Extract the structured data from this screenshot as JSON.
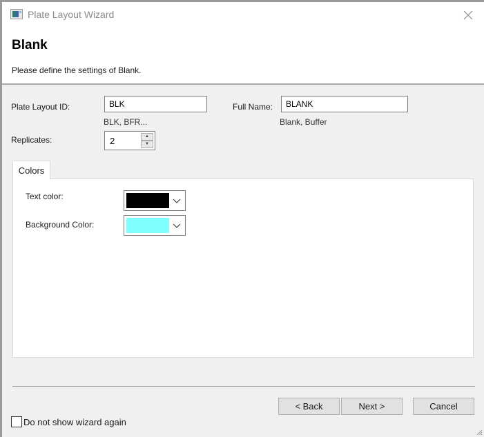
{
  "window": {
    "title": "Plate Layout Wizard",
    "close_icon": "close-icon",
    "app_icon": "plate-layout-app-icon"
  },
  "header": {
    "title": "Blank",
    "subtitle": "Please define the settings of Blank."
  },
  "form": {
    "plate_layout_id": {
      "label": "Plate Layout ID:",
      "value": "BLK",
      "hint": "BLK, BFR..."
    },
    "full_name": {
      "label": "Full Name:",
      "value": "BLANK",
      "hint": "Blank, Buffer"
    },
    "replicates": {
      "label": "Replicates:",
      "value": "2",
      "up_icon": "spin-up-icon",
      "down_icon": "spin-down-icon"
    }
  },
  "tabs": [
    {
      "label": "Colors",
      "active": true
    }
  ],
  "colors": {
    "text_color": {
      "label": "Text color:",
      "value": "#000000"
    },
    "background_color": {
      "label": "Background Color:",
      "value": "#80ffff"
    }
  },
  "footer": {
    "back_label": "< Back",
    "next_label": "Next >",
    "cancel_label": "Cancel",
    "do_not_show_label": "Do not show wizard again",
    "do_not_show_checked": false
  }
}
